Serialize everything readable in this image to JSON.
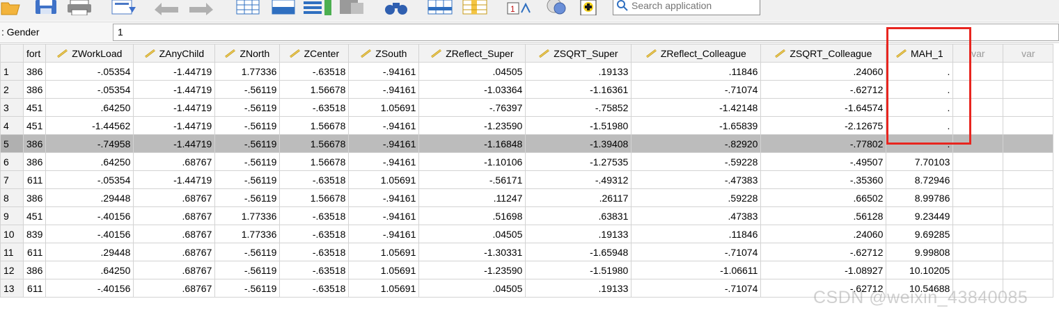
{
  "toolbar": {
    "search_placeholder": "Search application",
    "icons": [
      "open-folder-icon",
      "save-icon",
      "print-icon",
      "recall-dialog-icon",
      "undo-icon",
      "redo-icon",
      "goto-case-icon",
      "goto-variable-icon",
      "variables-icon",
      "find-icon",
      "binoculars-icon",
      "insert-cases-icon",
      "insert-variable-icon",
      "split-file-icon",
      "weight-cases-icon",
      "select-cases-icon",
      "value-labels-icon"
    ]
  },
  "cell_editor": {
    "reference": ": Gender",
    "value": "1"
  },
  "table": {
    "columns": [
      "fort",
      "ZWorkLoad",
      "ZAnyChild",
      "ZNorth",
      "ZCenter",
      "ZSouth",
      "ZReflect_Super",
      "ZSQRT_Super",
      "ZReflect_Colleague",
      "ZSQRT_Colleague",
      "MAH_1",
      "var",
      "var"
    ],
    "selected_row": 5,
    "rows": [
      {
        "n": "1",
        "cells": [
          "386",
          "-.05354",
          "-1.44719",
          "1.77336",
          "-.63518",
          "-.94161",
          ".04505",
          ".19133",
          ".11846",
          ".24060",
          "."
        ]
      },
      {
        "n": "2",
        "cells": [
          "386",
          "-.05354",
          "-1.44719",
          "-.56119",
          "1.56678",
          "-.94161",
          "-1.03364",
          "-1.16361",
          "-.71074",
          "-.62712",
          "."
        ]
      },
      {
        "n": "3",
        "cells": [
          "451",
          ".64250",
          "-1.44719",
          "-.56119",
          "-.63518",
          "1.05691",
          "-.76397",
          "-.75852",
          "-1.42148",
          "-1.64574",
          "."
        ]
      },
      {
        "n": "4",
        "cells": [
          "451",
          "-1.44562",
          "-1.44719",
          "-.56119",
          "1.56678",
          "-.94161",
          "-1.23590",
          "-1.51980",
          "-1.65839",
          "-2.12675",
          "."
        ]
      },
      {
        "n": "5",
        "cells": [
          "386",
          "-.74958",
          "-1.44719",
          "-.56119",
          "1.56678",
          "-.94161",
          "-1.16848",
          "-1.39408",
          "-.82920",
          "-.77802",
          "."
        ]
      },
      {
        "n": "6",
        "cells": [
          "386",
          ".64250",
          ".68767",
          "-.56119",
          "1.56678",
          "-.94161",
          "-1.10106",
          "-1.27535",
          "-.59228",
          "-.49507",
          "7.70103"
        ]
      },
      {
        "n": "7",
        "cells": [
          "611",
          "-.05354",
          "-1.44719",
          "-.56119",
          "-.63518",
          "1.05691",
          "-.56171",
          "-.49312",
          "-.47383",
          "-.35360",
          "8.72946"
        ]
      },
      {
        "n": "8",
        "cells": [
          "386",
          ".29448",
          ".68767",
          "-.56119",
          "1.56678",
          "-.94161",
          ".11247",
          ".26117",
          ".59228",
          ".66502",
          "8.99786"
        ]
      },
      {
        "n": "9",
        "cells": [
          "451",
          "-.40156",
          ".68767",
          "1.77336",
          "-.63518",
          "-.94161",
          ".51698",
          ".63831",
          ".47383",
          ".56128",
          "9.23449"
        ]
      },
      {
        "n": "10",
        "cells": [
          "839",
          "-.40156",
          ".68767",
          "1.77336",
          "-.63518",
          "-.94161",
          ".04505",
          ".19133",
          ".11846",
          ".24060",
          "9.69285"
        ]
      },
      {
        "n": "11",
        "cells": [
          "611",
          ".29448",
          ".68767",
          "-.56119",
          "-.63518",
          "1.05691",
          "-1.30331",
          "-1.65948",
          "-.71074",
          "-.62712",
          "9.99808"
        ]
      },
      {
        "n": "12",
        "cells": [
          "386",
          ".64250",
          ".68767",
          "-.56119",
          "-.63518",
          "1.05691",
          "-1.23590",
          "-1.51980",
          "-1.06611",
          "-1.08927",
          "10.10205"
        ]
      },
      {
        "n": "13",
        "cells": [
          "611",
          "-.40156",
          ".68767",
          "-.56119",
          "-.63518",
          "1.05691",
          ".04505",
          ".19133",
          "-.71074",
          "-.62712",
          "10.54688"
        ]
      }
    ]
  },
  "watermark": "CSDN @weixin_43840085",
  "colors": {
    "highlight_box": "#e8251f",
    "selected_row": "#bcbcbc",
    "header_bg": "#f2f2f2"
  }
}
